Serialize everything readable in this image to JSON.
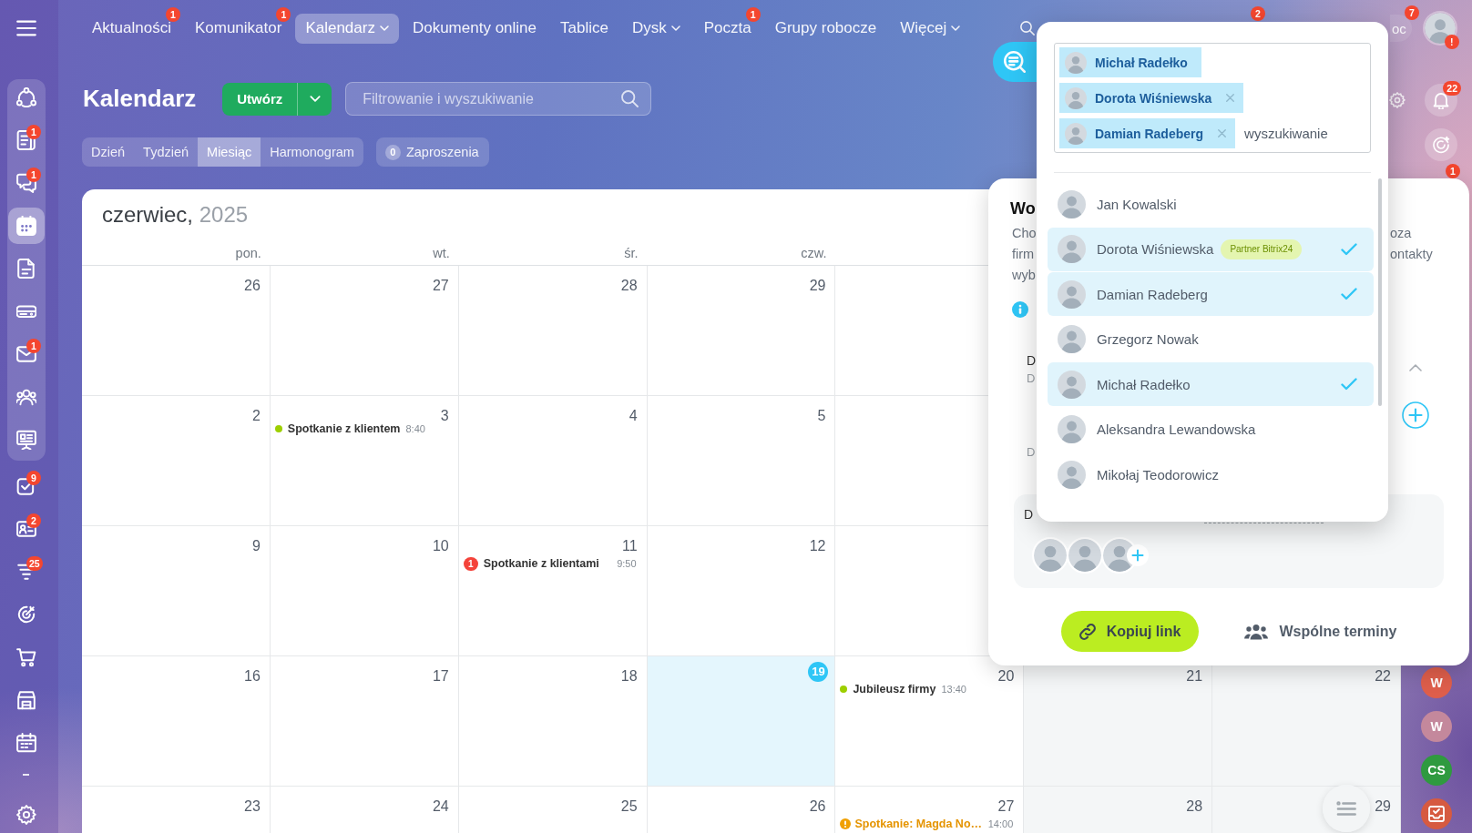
{
  "top_nav": {
    "items": [
      {
        "label": "Aktualności",
        "badge": "1",
        "selected": false,
        "has_menu": false
      },
      {
        "label": "Komunikator",
        "badge": "1",
        "selected": false,
        "has_menu": false
      },
      {
        "label": "Kalendarz",
        "selected": true,
        "has_menu": true
      },
      {
        "label": "Dokumenty online",
        "selected": false,
        "has_menu": false
      },
      {
        "label": "Tablice",
        "selected": false,
        "has_menu": false
      },
      {
        "label": "Dysk",
        "selected": false,
        "has_menu": true
      },
      {
        "label": "Poczta",
        "badge": "1",
        "selected": false,
        "has_menu": false
      },
      {
        "label": "Grupy robocze",
        "selected": false,
        "has_menu": false
      },
      {
        "label": "Więcej",
        "selected": false,
        "has_menu": true
      }
    ],
    "counter": "2",
    "help": {
      "label": "oc",
      "count": "7"
    },
    "profile_alert": "!"
  },
  "sidebar": {
    "items": [
      {
        "selected": false
      },
      {
        "selected": false,
        "badge": "1"
      },
      {
        "selected": false,
        "badge": "1"
      },
      {
        "selected": true
      },
      {
        "selected": false
      },
      {
        "selected": false
      },
      {
        "selected": false,
        "badge": "1"
      },
      {
        "selected": false
      },
      {
        "selected": false
      },
      {
        "selected": false,
        "badge": "9"
      },
      {
        "selected": false,
        "badge": "2"
      },
      {
        "selected": false,
        "badge": "25"
      },
      {
        "selected": false
      },
      {
        "selected": false
      },
      {
        "selected": false
      },
      {
        "selected": false
      }
    ]
  },
  "page_header": {
    "title": "Kalendarz",
    "create_button": "Utwórz",
    "search": {
      "placeholder": "Filtrowanie i wyszukiwanie"
    },
    "view_tabs": [
      {
        "label": "Dzień",
        "selected": false
      },
      {
        "label": "Tydzień",
        "selected": false
      },
      {
        "label": "Miesiąc",
        "selected": true
      },
      {
        "label": "Harmonogram",
        "selected": false
      }
    ],
    "invitations": {
      "count": "0",
      "label": "Zaproszenia"
    }
  },
  "calendar": {
    "month": "czerwiec,",
    "year": "2025",
    "weekdays": [
      "pon.",
      "wt.",
      "śr.",
      "czw."
    ],
    "weeks": [
      {
        "days": [
          {
            "kind": "weekday",
            "date": "26"
          },
          {
            "kind": "weekday",
            "date": "27"
          },
          {
            "kind": "weekday",
            "date": "28"
          },
          {
            "kind": "weekday",
            "date": "29"
          },
          {
            "kind": "weekday"
          },
          {
            "kind": "weekend"
          },
          {
            "kind": "weekend"
          }
        ]
      },
      {
        "days": [
          {
            "kind": "weekday",
            "date": "2"
          },
          {
            "kind": "weekday",
            "date": "3",
            "events": [
              {
                "kind": "dot",
                "color": "#9dcf00",
                "title": "Spotkanie z klientem",
                "time": "8:40"
              }
            ]
          },
          {
            "kind": "weekday",
            "date": "4"
          },
          {
            "kind": "weekday",
            "date": "5"
          },
          {
            "kind": "weekday"
          },
          {
            "kind": "weekend"
          },
          {
            "kind": "weekend"
          }
        ]
      },
      {
        "days": [
          {
            "kind": "weekday",
            "date": "9"
          },
          {
            "kind": "weekday",
            "date": "10"
          },
          {
            "kind": "weekday",
            "date": "11",
            "events": [
              {
                "kind": "counter",
                "count": "1",
                "title": "Spotkanie z klientami",
                "time": "9:50"
              }
            ]
          },
          {
            "kind": "weekday",
            "date": "12"
          },
          {
            "kind": "weekday"
          },
          {
            "kind": "weekend"
          },
          {
            "kind": "weekend"
          }
        ]
      },
      {
        "days": [
          {
            "kind": "weekday",
            "date": "16"
          },
          {
            "kind": "weekday",
            "date": "17"
          },
          {
            "kind": "weekday",
            "date": "18"
          },
          {
            "kind": "today",
            "date": "19"
          },
          {
            "kind": "weekday",
            "date": "20",
            "events": [
              {
                "kind": "dot",
                "color": "#9dcf00",
                "title": "Jubileusz firmy",
                "time": "13:40"
              }
            ]
          },
          {
            "kind": "weekend",
            "date": "21"
          },
          {
            "kind": "weekend",
            "date": "22"
          }
        ]
      },
      {
        "days": [
          {
            "kind": "weekday",
            "date": "23"
          },
          {
            "kind": "weekday",
            "date": "24"
          },
          {
            "kind": "weekday",
            "date": "25"
          },
          {
            "kind": "weekday",
            "date": "26"
          },
          {
            "kind": "weekday",
            "date": "27",
            "events": [
              {
                "kind": "pending",
                "title": "Spotkanie: Magda No…",
                "time": "14:00"
              }
            ]
          },
          {
            "kind": "weekend",
            "date": "28"
          },
          {
            "kind": "weekend",
            "date": "29"
          }
        ]
      }
    ]
  },
  "shared_slots": {
    "title": "Wo",
    "left_lines": [
      "Cho",
      "firm",
      "wyb"
    ],
    "right_lines": [
      "oza",
      "ontakty"
    ],
    "section_label": "D",
    "section_hint": "D",
    "field_hint": "D",
    "participants_label": "D",
    "copy_link": "Kopiuj link",
    "common_slots": "Wspólne terminy"
  },
  "participant_picker": {
    "tags": [
      {
        "name": "Michał Radełko",
        "removable": false
      },
      {
        "name": "Dorota Wiśniewska",
        "removable": true
      },
      {
        "name": "Damian Radeberg",
        "removable": true
      }
    ],
    "search": {
      "placeholder": "wyszukiwanie"
    },
    "options": [
      {
        "name": "Jan Kowalski",
        "selected": false
      },
      {
        "name": "Dorota Wiśniewska",
        "selected": true,
        "badge": "Partner Bitrix24"
      },
      {
        "name": "Damian Radeberg",
        "selected": true
      },
      {
        "name": "Grzegorz Nowak",
        "selected": false
      },
      {
        "name": "Michał Radełko",
        "selected": true
      },
      {
        "name": "Aleksandra Lewandowska",
        "selected": false
      },
      {
        "name": "Mikołaj Teodorowicz",
        "selected": false
      }
    ]
  },
  "right_rail": {
    "notification_count": "22",
    "count": "1",
    "chats": [
      {
        "kind": "initials",
        "text": "W",
        "color": "#de5e4b"
      },
      {
        "kind": "initials",
        "text": "W",
        "color": "#c4889c"
      },
      {
        "kind": "initials",
        "text": "CS",
        "color": "#2f9a3f"
      },
      {
        "kind": "icon",
        "color": "#d65a40"
      }
    ]
  }
}
